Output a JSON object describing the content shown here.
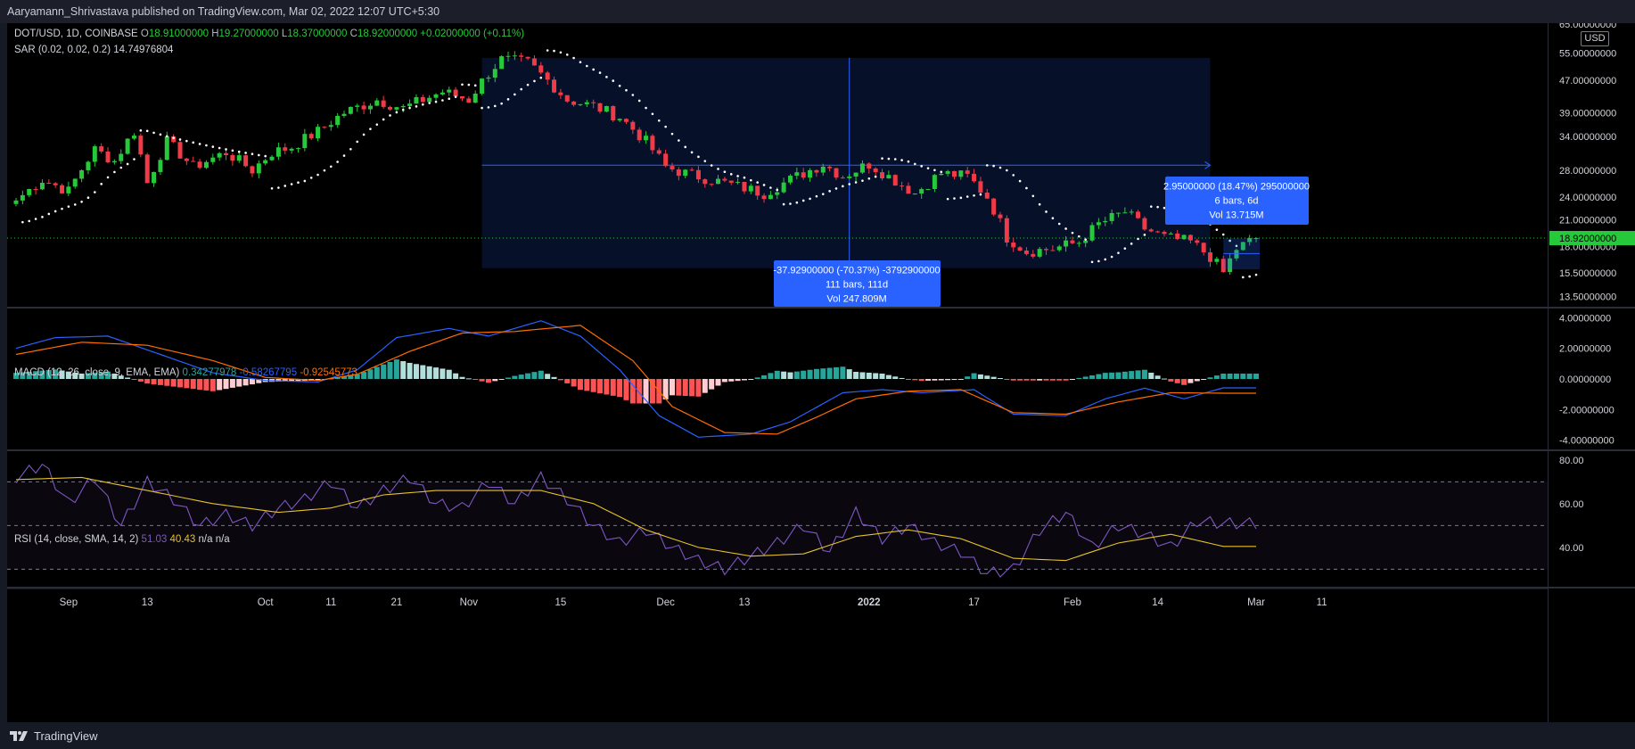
{
  "header": {
    "publisher": "Aaryamann_Shrivastava published on TradingView.com, Mar 02, 2022 12:07 UTC+5:30"
  },
  "legend": {
    "symbol": "DOT/USD, 1D, COINBASE",
    "open_label": "O",
    "open": "18.91000000",
    "high_label": "H",
    "high": "19.27000000",
    "low_label": "L",
    "low": "18.37000000",
    "close_label": "C",
    "close": "18.92000000",
    "change": "+0.02000000 (+0.11%)",
    "sar_label": "SAR (0.02, 0.02, 0.2)",
    "sar_value": "14.74976804",
    "macd_label": "MACD (12, 26, close, 9, EMA, EMA)",
    "macd_hist": "0.34277978",
    "macd_line": "-0.58267795",
    "macd_signal": "-0.92545773",
    "rsi_label": "RSI (14, close, SMA, 14, 2)",
    "rsi_value": "51.03",
    "rsi_ma": "40.43",
    "rsi_na1": "n/a",
    "rsi_na2": "n/a"
  },
  "currency": "USD",
  "current_price": "18.92000000",
  "colors": {
    "up": "#26c93a",
    "down": "#f03a46",
    "macd_line": "#2962ff",
    "macd_signal": "#ff6d00",
    "hist_up_strong": "#26a69a",
    "hist_up_weak": "#b2dfdb",
    "hist_down_strong": "#ff5252",
    "hist_down_weak": "#ffcdd2",
    "rsi": "#7e57c2",
    "rsi_ma": "#e6c229",
    "measure": "#2962ff"
  },
  "chart_data": [
    {
      "type": "candlestick",
      "title": "DOT/USD, 1D, COINBASE",
      "ylim": [
        13,
        64
      ],
      "y_ticks": [
        "65.00000000",
        "55.00000000",
        "47.00000000",
        "39.00000000",
        "34.00000000",
        "28.00000000",
        "24.00000000",
        "21.00000000",
        "18.00000000",
        "15.50000000",
        "13.50000000"
      ],
      "x_ticks": [
        "Sep",
        "13",
        "Oct",
        "11",
        "21",
        "Nov",
        "15",
        "Dec",
        "13",
        "2022",
        "17",
        "Feb",
        "14",
        "Mar",
        "11"
      ],
      "close_path": [
        [
          "2021-08-24",
          23.5
        ],
        [
          "2021-08-28",
          26.5
        ],
        [
          "2021-09-01",
          24.8
        ],
        [
          "2021-09-05",
          31.5
        ],
        [
          "2021-09-08",
          29.5
        ],
        [
          "2021-09-11",
          35
        ],
        [
          "2021-09-13",
          26
        ],
        [
          "2021-09-16",
          33
        ],
        [
          "2021-09-20",
          28.5
        ],
        [
          "2021-09-25",
          31
        ],
        [
          "2021-09-29",
          28
        ],
        [
          "2021-10-02",
          31
        ],
        [
          "2021-10-05",
          32
        ],
        [
          "2021-10-09",
          35
        ],
        [
          "2021-10-13",
          39
        ],
        [
          "2021-10-18",
          42
        ],
        [
          "2021-10-22",
          40
        ],
        [
          "2021-10-28",
          44
        ],
        [
          "2021-11-01",
          42
        ],
        [
          "2021-11-04",
          49
        ],
        [
          "2021-11-06",
          53
        ],
        [
          "2021-11-10",
          52
        ],
        [
          "2021-11-13",
          47
        ],
        [
          "2021-11-16",
          42
        ],
        [
          "2021-11-20",
          40.5
        ],
        [
          "2021-11-24",
          38
        ],
        [
          "2021-11-28",
          33
        ],
        [
          "2021-12-01",
          28.5
        ],
        [
          "2021-12-04",
          27.5
        ],
        [
          "2021-12-08",
          26.5
        ],
        [
          "2021-12-12",
          25.5
        ],
        [
          "2021-12-16",
          24.5
        ],
        [
          "2021-12-21",
          27
        ],
        [
          "2021-12-25",
          29
        ],
        [
          "2021-12-28",
          27
        ],
        [
          "2022-01-01",
          29
        ],
        [
          "2022-01-04",
          27
        ],
        [
          "2022-01-08",
          24.5
        ],
        [
          "2022-01-12",
          27.5
        ],
        [
          "2022-01-16",
          27
        ],
        [
          "2022-01-19",
          24
        ],
        [
          "2022-01-22",
          19
        ],
        [
          "2022-01-25",
          17.5
        ],
        [
          "2022-01-29",
          17.8
        ],
        [
          "2022-02-02",
          18.5
        ],
        [
          "2022-02-05",
          20.5
        ],
        [
          "2022-02-09",
          22
        ],
        [
          "2022-02-12",
          20
        ],
        [
          "2022-02-15",
          19
        ],
        [
          "2022-02-19",
          18.5
        ],
        [
          "2022-02-22",
          17
        ],
        [
          "2022-02-24",
          15.5
        ],
        [
          "2022-02-26",
          17.8
        ],
        [
          "2022-03-01",
          18.92
        ]
      ],
      "sar_value": 14.74976804,
      "measure_1": {
        "text": "-37.92900000 (-70.37%) -3792900000",
        "bars": "111 bars, 111d",
        "vol": "Vol 247.809M"
      },
      "measure_2": {
        "text": "2.95000000 (18.47%) 295000000",
        "bars": "6 bars, 6d",
        "vol": "Vol 13.715M"
      }
    },
    {
      "type": "macd",
      "ylim": [
        -4.6,
        4.6
      ],
      "y_ticks": [
        "4.00000000",
        "2.00000000",
        "0.00000000",
        "-2.00000000",
        "-4.00000000"
      ],
      "macd": [
        [
          0,
          2
        ],
        [
          6,
          2.7
        ],
        [
          14,
          2.8
        ],
        [
          22,
          1.6
        ],
        [
          30,
          0.4
        ],
        [
          38,
          -0.1
        ],
        [
          46,
          -0.2
        ],
        [
          52,
          0.6
        ],
        [
          58,
          2.7
        ],
        [
          66,
          3.3
        ],
        [
          72,
          2.8
        ],
        [
          80,
          3.8
        ],
        [
          86,
          2.8
        ],
        [
          92,
          0.6
        ],
        [
          98,
          -2.4
        ],
        [
          104,
          -3.8
        ],
        [
          112,
          -3.6
        ],
        [
          118,
          -2.8
        ],
        [
          126,
          -0.9
        ],
        [
          132,
          -0.7
        ],
        [
          138,
          -0.9
        ],
        [
          146,
          -0.7
        ],
        [
          152,
          -2.3
        ],
        [
          160,
          -2.4
        ],
        [
          166,
          -1.3
        ],
        [
          172,
          -0.6
        ],
        [
          178,
          -1.3
        ],
        [
          184,
          -0.58
        ]
      ],
      "signal": [
        [
          0,
          1.6
        ],
        [
          10,
          2.4
        ],
        [
          20,
          2.2
        ],
        [
          30,
          1.2
        ],
        [
          38,
          0.1
        ],
        [
          46,
          -0.1
        ],
        [
          52,
          0.3
        ],
        [
          60,
          1.8
        ],
        [
          68,
          3.0
        ],
        [
          76,
          3.1
        ],
        [
          86,
          3.5
        ],
        [
          94,
          1.2
        ],
        [
          100,
          -1.8
        ],
        [
          108,
          -3.5
        ],
        [
          116,
          -3.6
        ],
        [
          122,
          -2.5
        ],
        [
          128,
          -1.3
        ],
        [
          136,
          -0.8
        ],
        [
          144,
          -0.7
        ],
        [
          152,
          -2.2
        ],
        [
          160,
          -2.3
        ],
        [
          168,
          -1.5
        ],
        [
          176,
          -0.9
        ],
        [
          184,
          -0.93
        ]
      ]
    },
    {
      "type": "rsi",
      "ylim": [
        22,
        84
      ],
      "y_ticks": [
        "80.00",
        "60.00",
        "40.00"
      ],
      "levels": [
        70,
        50,
        30
      ],
      "rsi": [
        [
          0,
          72
        ],
        [
          4,
          78
        ],
        [
          8,
          60
        ],
        [
          12,
          72
        ],
        [
          16,
          50
        ],
        [
          20,
          70
        ],
        [
          24,
          62
        ],
        [
          28,
          50
        ],
        [
          32,
          55
        ],
        [
          36,
          50
        ],
        [
          40,
          58
        ],
        [
          44,
          62
        ],
        [
          48,
          70
        ],
        [
          52,
          58
        ],
        [
          56,
          66
        ],
        [
          60,
          72
        ],
        [
          64,
          60
        ],
        [
          68,
          58
        ],
        [
          72,
          70
        ],
        [
          76,
          60
        ],
        [
          80,
          72
        ],
        [
          84,
          62
        ],
        [
          88,
          50
        ],
        [
          92,
          42
        ],
        [
          96,
          48
        ],
        [
          100,
          40
        ],
        [
          104,
          34
        ],
        [
          108,
          30
        ],
        [
          112,
          36
        ],
        [
          116,
          42
        ],
        [
          120,
          50
        ],
        [
          124,
          38
        ],
        [
          128,
          56
        ],
        [
          132,
          44
        ],
        [
          136,
          50
        ],
        [
          140,
          42
        ],
        [
          144,
          38
        ],
        [
          148,
          28
        ],
        [
          152,
          30
        ],
        [
          156,
          48
        ],
        [
          160,
          56
        ],
        [
          164,
          40
        ],
        [
          168,
          50
        ],
        [
          172,
          46
        ],
        [
          176,
          40
        ],
        [
          180,
          52
        ],
        [
          184,
          51.03
        ]
      ],
      "ma": [
        [
          0,
          71
        ],
        [
          10,
          72
        ],
        [
          20,
          66
        ],
        [
          30,
          60
        ],
        [
          40,
          56
        ],
        [
          48,
          58
        ],
        [
          56,
          64
        ],
        [
          64,
          66
        ],
        [
          72,
          66
        ],
        [
          80,
          66
        ],
        [
          88,
          60
        ],
        [
          96,
          48
        ],
        [
          104,
          40
        ],
        [
          112,
          36
        ],
        [
          120,
          37
        ],
        [
          128,
          45
        ],
        [
          136,
          48
        ],
        [
          144,
          44
        ],
        [
          152,
          35
        ],
        [
          160,
          34
        ],
        [
          168,
          42
        ],
        [
          176,
          46
        ],
        [
          184,
          40.43
        ]
      ]
    }
  ]
}
